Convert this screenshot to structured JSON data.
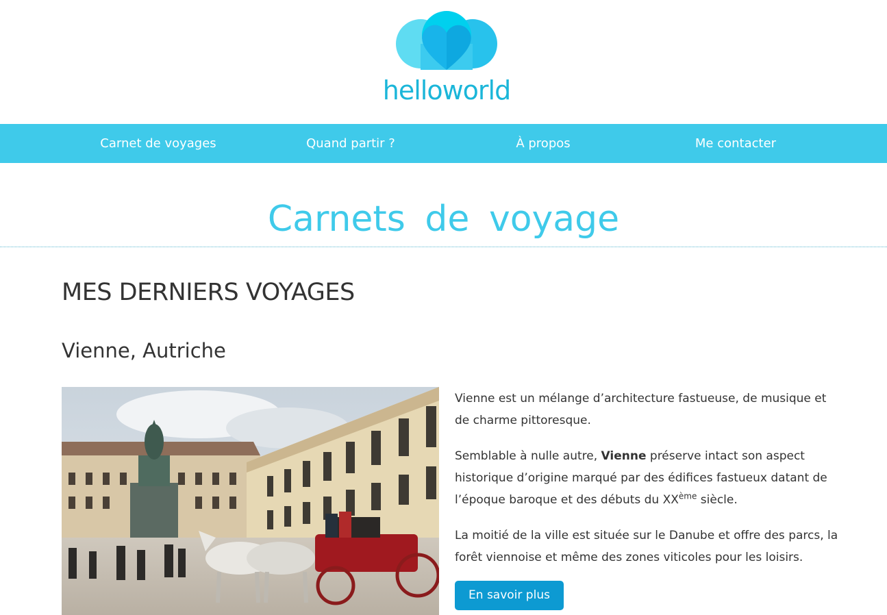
{
  "brand": {
    "logo_text": "helloworld",
    "primary_color": "#3fcaea",
    "button_color": "#0d9ad2"
  },
  "nav": {
    "items": [
      {
        "label": "Carnet de voyages"
      },
      {
        "label": "Quand partir ?"
      },
      {
        "label": "À propos"
      },
      {
        "label": "Me contacter"
      }
    ]
  },
  "page": {
    "title": "Carnets de voyage"
  },
  "section": {
    "heading": "MES DERNIERS VOYAGES"
  },
  "article": {
    "city": "Vienne, Autriche",
    "p1": "Vienne est un mélange d’architecture fastueuse, de musique et de charme pittoresque.",
    "p2_before": "Semblable à nulle autre, ",
    "p2_bold": "Vienne",
    "p2_after": " préserve intact son aspect historique d’origine marqué par des édifices fastueux datant de l’époque baroque et des débuts du XX",
    "p2_sup": "ème",
    "p2_end": " siècle.",
    "p3": "La moitié de la ville est située sur le Danube et offre des parcs, la forêt viennoise et même des zones viticoles pour les loisirs.",
    "cta_label": "En savoir plus"
  }
}
